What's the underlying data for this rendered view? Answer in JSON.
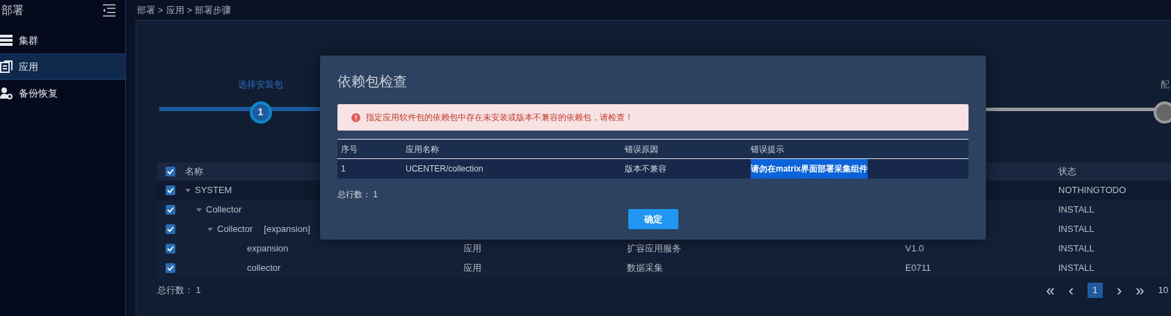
{
  "sidebar": {
    "title": "部署",
    "items": [
      {
        "label": "集群",
        "selected": false
      },
      {
        "label": "应用",
        "selected": true
      },
      {
        "label": "备份恢复",
        "selected": false
      }
    ]
  },
  "breadcrumb": [
    "部署",
    "应用",
    "部署步骤"
  ],
  "breadcrumb_separator": ">",
  "steps": [
    {
      "label": "选择安装包",
      "number": "1",
      "active": true
    },
    {
      "label": "配",
      "active": false
    }
  ],
  "table": {
    "header": {
      "name": "名称",
      "status": "状态",
      "checked": true
    },
    "rows": [
      {
        "name": "SYSTEM",
        "checked": true,
        "expanded": true,
        "status": "NOTHINGTODO",
        "children": [
          {
            "name": "Collector",
            "checked": true,
            "expanded": true,
            "status": "INSTALL",
            "children": [
              {
                "name": "Collector",
                "tag": "[expansion]",
                "checked": true,
                "expanded": true,
                "status": "INSTALL",
                "children": [
                  {
                    "name": "expansion",
                    "checked": true,
                    "column_2": "应用",
                    "column_3": "扩容应用服务",
                    "column_4": "V1.0",
                    "status": "INSTALL"
                  },
                  {
                    "name": "collector",
                    "checked": true,
                    "column_2": "应用",
                    "column_3": "数据采集",
                    "column_4": "E0711",
                    "status": "INSTALL"
                  }
                ]
              }
            ]
          }
        ]
      }
    ],
    "total": "总行数： 1"
  },
  "pagination": {
    "first": "«",
    "prev": "‹",
    "pages": [
      {
        "label": "1",
        "selected": true
      }
    ],
    "next": "›",
    "last": "»",
    "page_size": "10"
  },
  "dialog": {
    "title": "依赖包检查",
    "alert": "指定应用软件包的依赖包中存在未安装或版本不兼容的依赖包，请检查！",
    "columns": [
      "序号",
      "应用名称",
      "错误原因",
      "错误提示"
    ],
    "rows": [
      {
        "cells": [
          {
            "text": "1",
            "selected": false
          },
          {
            "text": "UCENTER/collection",
            "selected": false
          },
          {
            "text": "版本不兼容",
            "selected": false
          },
          {
            "text": "请勿在matrix界面部署采集组件",
            "selected": true
          }
        ]
      }
    ],
    "total": "总行数： 1",
    "button": "确定"
  }
}
